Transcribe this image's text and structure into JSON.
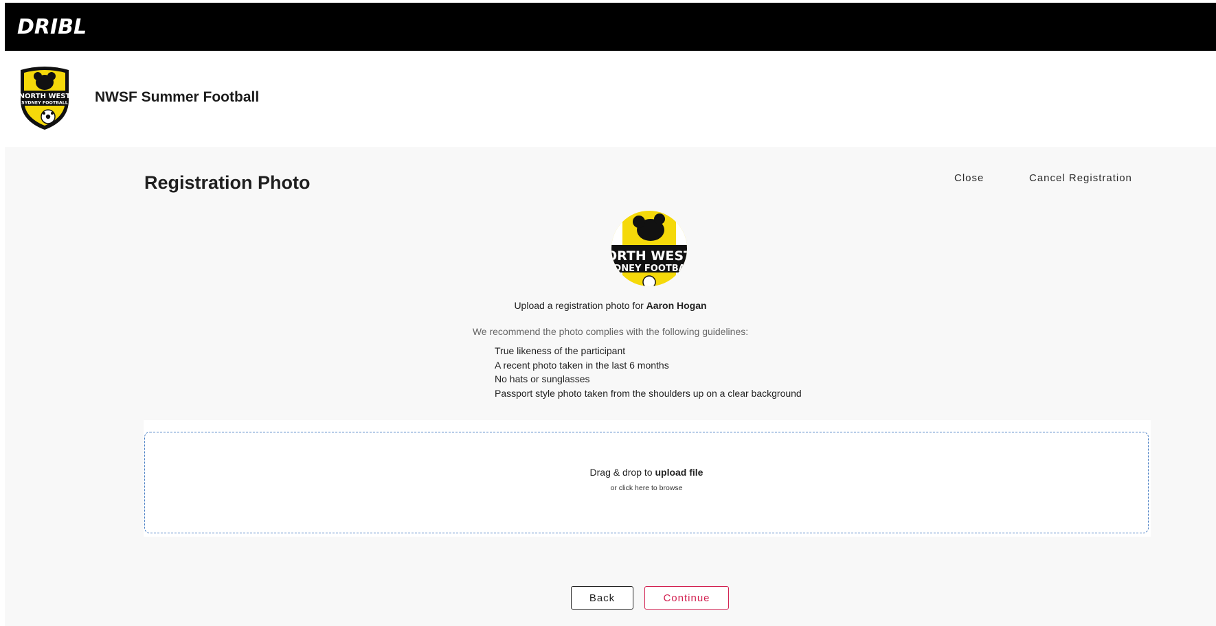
{
  "brand": {
    "name": "DRIBL"
  },
  "org": {
    "name": "NWSF Summer Football",
    "logo_icon": "north-west-sydney-football-crest-icon",
    "logo_text_top": "NORTH WEST",
    "logo_text_bottom": "SYDNEY FOOTBALL"
  },
  "page": {
    "title": "Registration Photo",
    "close_label": "Close",
    "cancel_label": "Cancel Registration"
  },
  "avatar": {
    "icon": "koala-avatar-icon",
    "text_top": "ORTH WEST",
    "text_bottom": "YDNEY FOOTBAL"
  },
  "upload": {
    "prompt_prefix": "Upload a registration photo for",
    "participant_name": "Aaron Hogan",
    "guidelines_intro": "We recommend the photo complies with the following guidelines:",
    "guidelines": [
      "True likeness of the participant",
      "A recent photo taken in the last 6 months",
      "No hats or sunglasses",
      "Passport style photo taken from the shoulders up on a clear background"
    ]
  },
  "dropzone": {
    "title_prefix": "Drag & drop to",
    "title_bold": "upload file",
    "subtitle": "or click here to browse"
  },
  "actions": {
    "back_label": "Back",
    "continue_label": "Continue"
  },
  "colors": {
    "topbar": "#000000",
    "main_bg": "#f8f8f8",
    "accent": "#d21f4f",
    "dropzone_border": "#4a7fc4",
    "crest_yellow": "#f5d90a"
  }
}
